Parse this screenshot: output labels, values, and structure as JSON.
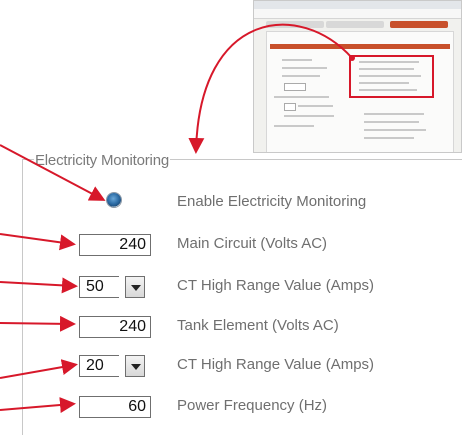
{
  "group": {
    "legend": "Electricity Monitoring"
  },
  "rows": [
    {
      "label": "Enable Electricity Monitoring"
    },
    {
      "value": "240",
      "label": "Main Circuit (Volts AC)"
    },
    {
      "value": "50",
      "label": "CT High Range Value (Amps)"
    },
    {
      "value": "240",
      "label": "Tank Element (Volts AC)"
    },
    {
      "value": "20",
      "label": "CT High Range Value (Amps)"
    },
    {
      "value": "60",
      "label": "Power Frequency (Hz)"
    }
  ],
  "colors": {
    "arrow": "#d7182a",
    "accent_tab": "#c8502b",
    "radio": "#2f6fa8"
  }
}
